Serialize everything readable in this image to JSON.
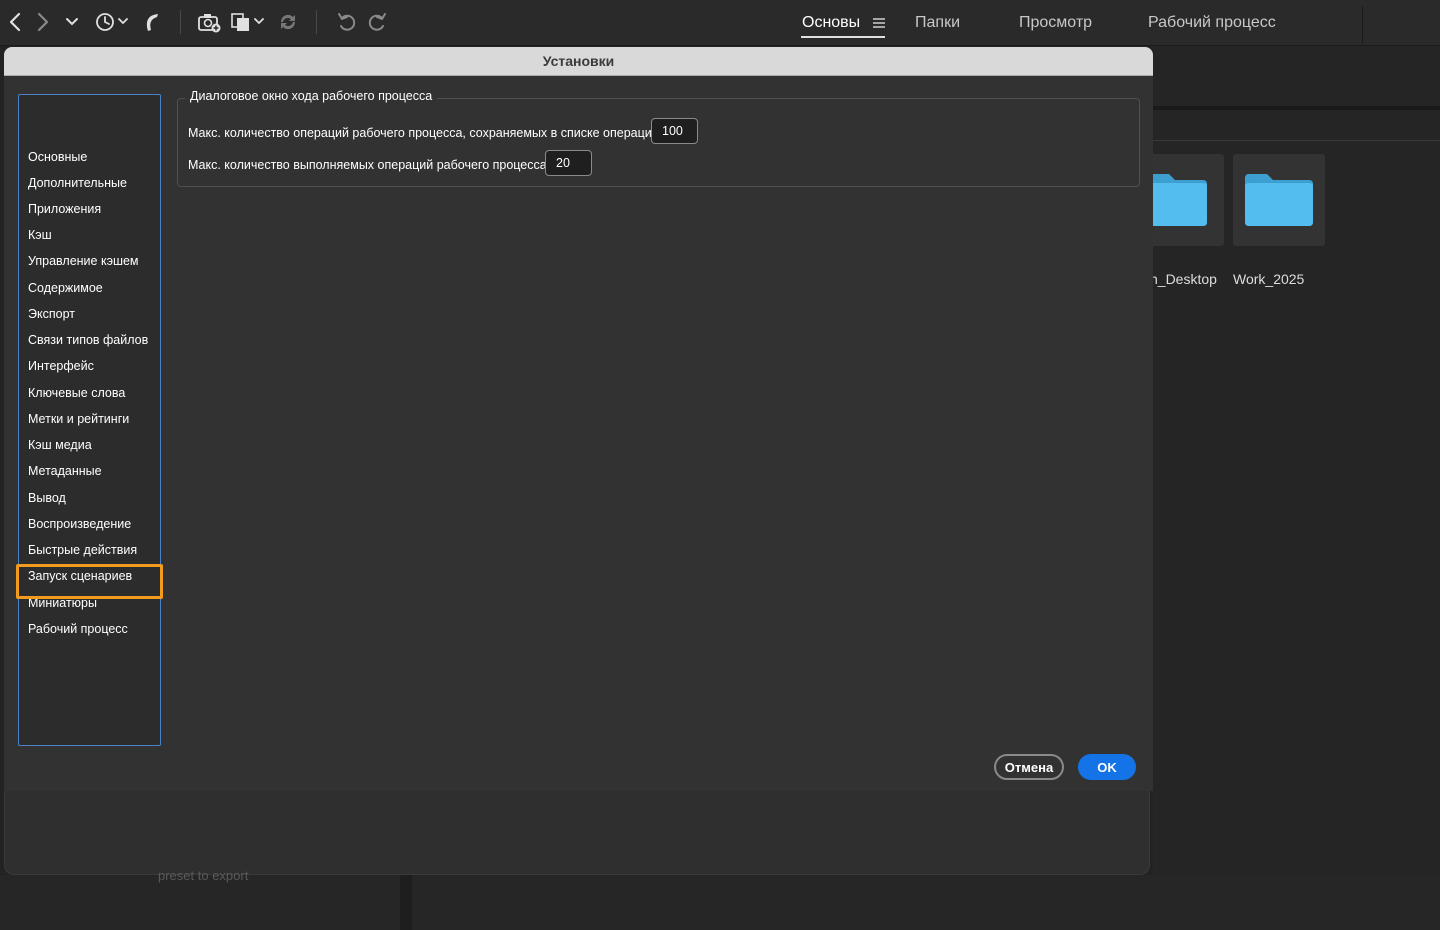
{
  "toolbar": {
    "icons": [
      "back-icon",
      "forward-icon",
      "chevron-down-icon",
      "history-icon",
      "boomerang-icon",
      "camera-import-icon",
      "copy-stack-icon",
      "sync-icon",
      "undo-icon",
      "redo-icon"
    ]
  },
  "workspaces": {
    "tabs": [
      {
        "label": "Основы",
        "active": true
      },
      {
        "label": "Папки",
        "active": false
      },
      {
        "label": "Просмотр",
        "active": false
      },
      {
        "label": "Рабочий процесс",
        "active": false
      }
    ]
  },
  "background": {
    "folders": [
      {
        "label": "h_Desktop"
      },
      {
        "label": "Work_2025"
      }
    ],
    "hint": "preset to export"
  },
  "dialog": {
    "title": "Установки",
    "categories": [
      "Основные",
      "Дополнительные",
      "Приложения",
      "Кэш",
      "Управление кэшем",
      "Содержимое",
      "Экспорт",
      "Связи типов файлов",
      "Интерфейс",
      "Ключевые слова",
      "Метки и рейтинги",
      "Кэш медиа",
      "Метаданные",
      "Вывод",
      "Воспроизведение",
      "Быстрые действия",
      "Запуск сценариев",
      "Миниатюры",
      "Рабочий процесс"
    ],
    "selected_category": "Рабочий процесс",
    "group": {
      "title": "Диалоговое окно хода рабочего процесса",
      "fields": [
        {
          "label": "Макс. количество операций рабочего процесса, сохраняемых в списке операций",
          "value": "100"
        },
        {
          "label": "Макс. количество выполняемых операций рабочего процесса",
          "value": "20"
        }
      ]
    },
    "buttons": {
      "cancel": "Отмена",
      "ok": "OK"
    }
  },
  "colors": {
    "accent": "#1473e6",
    "highlight": "#f29b1d",
    "folder": "#4fb6e6"
  }
}
